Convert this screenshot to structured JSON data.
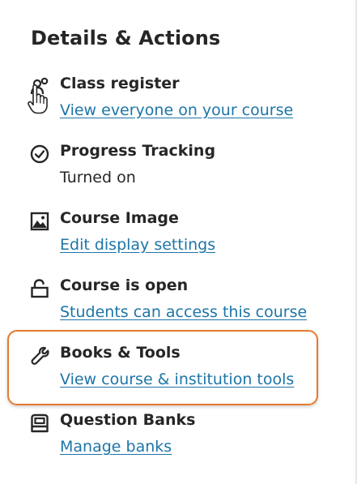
{
  "panel": {
    "title": "Details & Actions"
  },
  "items": [
    {
      "label": "Class register",
      "link": "View everyone on your course",
      "icon": "class-register-icon"
    },
    {
      "label": "Progress Tracking",
      "status": "Turned on",
      "icon": "progress-check-icon"
    },
    {
      "label": "Course Image",
      "link": "Edit display settings",
      "icon": "image-icon"
    },
    {
      "label": "Course is open",
      "link": "Students can access this course",
      "icon": "unlock-icon"
    },
    {
      "label": "Books & Tools",
      "link": "View course & institution tools",
      "icon": "wrench-icon"
    },
    {
      "label": "Question Banks",
      "link": "Manage banks",
      "icon": "question-bank-icon"
    }
  ],
  "colors": {
    "link": "#1d75a8",
    "text": "#262626",
    "highlight": "#e47a2e"
  }
}
